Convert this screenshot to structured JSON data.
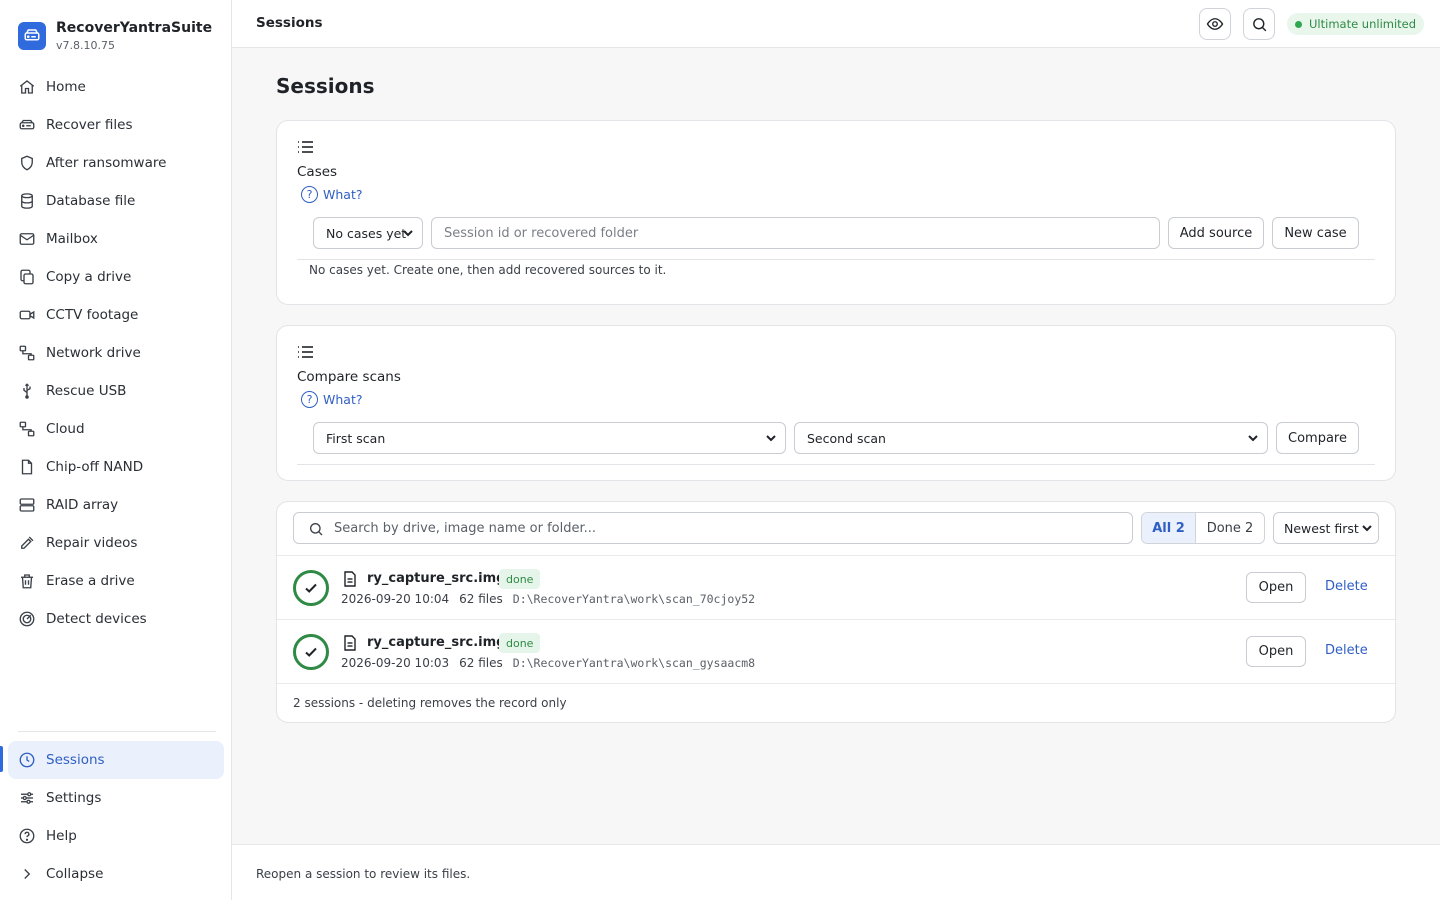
{
  "app": {
    "name": "RecoverYantraSuite",
    "version": "v7.8.10.75"
  },
  "sidebar": {
    "items": [
      {
        "label": "Home",
        "icon": "home-icon"
      },
      {
        "label": "Recover files",
        "icon": "drive-icon"
      },
      {
        "label": "After ransomware",
        "icon": "shield-icon"
      },
      {
        "label": "Database file",
        "icon": "database-icon"
      },
      {
        "label": "Mailbox",
        "icon": "mail-icon"
      },
      {
        "label": "Copy a drive",
        "icon": "copy-icon"
      },
      {
        "label": "CCTV footage",
        "icon": "video-icon"
      },
      {
        "label": "Network drive",
        "icon": "network-icon"
      },
      {
        "label": "Rescue USB",
        "icon": "usb-icon"
      },
      {
        "label": "Cloud",
        "icon": "cloud-network-icon"
      },
      {
        "label": "Chip-off NAND",
        "icon": "file-icon"
      },
      {
        "label": "RAID array",
        "icon": "raid-icon"
      },
      {
        "label": "Repair videos",
        "icon": "wrench-icon"
      },
      {
        "label": "Erase a drive",
        "icon": "trash-icon"
      },
      {
        "label": "Detect devices",
        "icon": "radar-icon"
      }
    ],
    "bottom": [
      {
        "label": "Sessions",
        "icon": "clock-icon"
      },
      {
        "label": "Settings",
        "icon": "sliders-icon"
      },
      {
        "label": "Help",
        "icon": "help-icon"
      },
      {
        "label": "Collapse",
        "icon": "chevron-right-icon"
      }
    ]
  },
  "topbar": {
    "title": "Sessions",
    "plan": "Ultimate unlimited"
  },
  "page": {
    "title": "Sessions"
  },
  "cases": {
    "title": "Cases",
    "what": "What?",
    "select": "No cases yet",
    "input_placeholder": "Session id or recovered folder",
    "add_source": "Add source",
    "new_case": "New case",
    "note": "No cases yet. Create one, then add recovered sources to it."
  },
  "compare": {
    "title": "Compare scans",
    "what": "What?",
    "first": "First scan",
    "second": "Second scan",
    "button": "Compare"
  },
  "sessions": {
    "search_placeholder": "Search by drive, image name or folder...",
    "filter_all": "All 2",
    "filter_done": "Done 2",
    "sort": "Newest first",
    "rows": [
      {
        "name": "ry_capture_src.img",
        "status": "done",
        "date": "2026-09-20 10:04",
        "files": "62 files",
        "path": "D:\\RecoverYantra\\work\\scan_70cjoy52",
        "open": "Open",
        "delete": "Delete"
      },
      {
        "name": "ry_capture_src.img",
        "status": "done",
        "date": "2026-09-20 10:03",
        "files": "62 files",
        "path": "D:\\RecoverYantra\\work\\scan_gysaacm8",
        "open": "Open",
        "delete": "Delete"
      }
    ],
    "footer": "2 sessions - deleting removes the record only"
  },
  "footer": {
    "text": "Reopen a session to review its files."
  }
}
